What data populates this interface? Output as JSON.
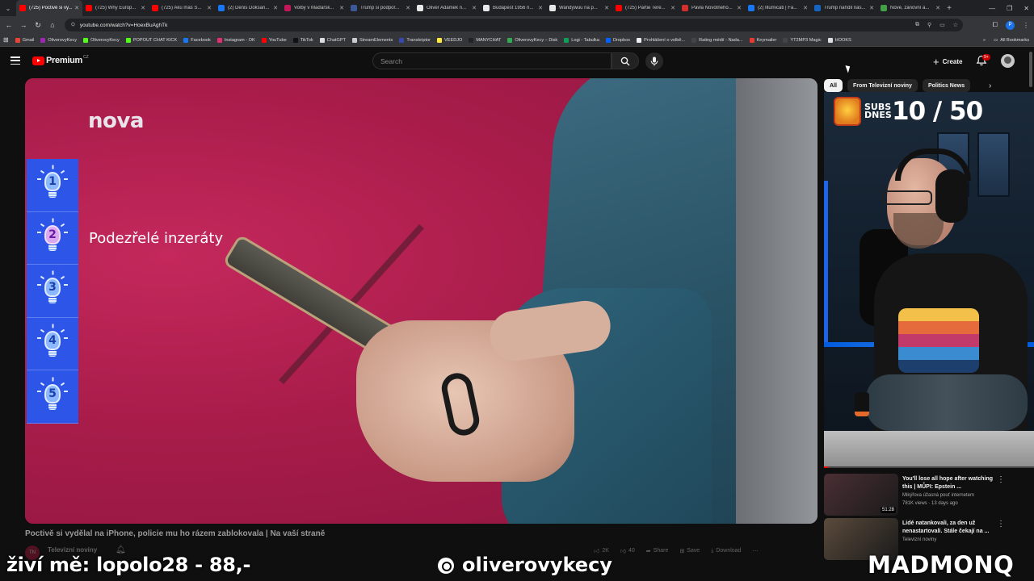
{
  "browser": {
    "tabs": [
      {
        "label": "(725) Poctivě si vy...",
        "color": "#ff0000",
        "active": true
      },
      {
        "label": "(725) Why Europ...",
        "color": "#ff0000"
      },
      {
        "label": "(725) Akú máš S...",
        "color": "#ff0000"
      },
      {
        "label": "(2) Denis Doksan...",
        "color": "#1877f2"
      },
      {
        "label": "Volby v Maďarsk...",
        "color": "#c2185b"
      },
      {
        "label": "Trump si podpor...",
        "color": "#3b5998"
      },
      {
        "label": "Oliver Adámek n...",
        "color": "#e8e8e8"
      },
      {
        "label": "Budapest 1956 n...",
        "color": "#e8e8e8"
      },
      {
        "label": "Wandywuu na p...",
        "color": "#e8e8e8"
      },
      {
        "label": "(725) Partie Tere...",
        "color": "#ff0000"
      },
      {
        "label": "Pavla Novotného...",
        "color": "#d32f2f"
      },
      {
        "label": "(2) Illumicati | Fa...",
        "color": "#1877f2"
      },
      {
        "label": "Trump nařídil nás...",
        "color": "#1565c0"
      },
      {
        "label": "Nové, zánovní a...",
        "color": "#43a047"
      }
    ],
    "url": "youtube.com/watch?v=HoexBuAghTk",
    "profile_initial": "P",
    "bookmarks": [
      {
        "label": "Gmail",
        "color": "#ea4335"
      },
      {
        "label": "OliverovyKecy",
        "color": "#9c27b0"
      },
      {
        "label": "OliverovyKecy",
        "color": "#53fc18"
      },
      {
        "label": "POPOUT CHAT KICK",
        "color": "#53fc18"
      },
      {
        "label": "Facebook",
        "color": "#1877f2"
      },
      {
        "label": "Instagram - OK",
        "color": "#e1306c"
      },
      {
        "label": "YouTube",
        "color": "#ff0000"
      },
      {
        "label": "TikTok",
        "color": "#111111"
      },
      {
        "label": "ChatGPT",
        "color": "#dddddd"
      },
      {
        "label": "StreamElements",
        "color": "#cccccc"
      },
      {
        "label": "Transkriptor",
        "color": "#3949ab"
      },
      {
        "label": "VEEDJO",
        "color": "#ffeb3b"
      },
      {
        "label": "MANYCHAT",
        "color": "#222222"
      },
      {
        "label": "OliverovyKecy – Disk",
        "color": "#34a853"
      },
      {
        "label": "Logi - Tabulka",
        "color": "#0f9d58"
      },
      {
        "label": "Dropbox",
        "color": "#0061ff"
      },
      {
        "label": "Prohlášení o volbě...",
        "color": "#eeeeee"
      },
      {
        "label": "Rating médií - Nada...",
        "color": "#444444"
      },
      {
        "label": "Keymailer",
        "color": "#e53935"
      },
      {
        "label": "YT2MP3 Magic",
        "color": "#444444"
      },
      {
        "label": "HOOKS",
        "color": "#dddddd"
      }
    ],
    "all_bookmarks": "All Bookmarks"
  },
  "youtube": {
    "logo_text": "Premium",
    "logo_region": "CZ",
    "search_placeholder": "Search",
    "create_label": "Create",
    "notif_badge": "9+"
  },
  "video": {
    "nova_logo": "nova",
    "steps": [
      "1",
      "2",
      "3",
      "4",
      "5"
    ],
    "active_step": 2,
    "step_label": "Podezřelé inzeráty",
    "title": "Poctivě si vydělal na iPhone, policie mu ho rázem zablokovala | Na vaší straně",
    "channel": "Televizní noviny",
    "channel_abbr": "TN",
    "likes": "2K",
    "dislikes_placeholder": "40",
    "share": "Share",
    "save": "Save",
    "download": "Download"
  },
  "sidebar": {
    "chips": [
      "All",
      "From Televizní noviny",
      "Politics News"
    ],
    "subs_label": "SUBS DNES",
    "subs_count": "10 / 50",
    "webcam_progress": 0.02,
    "recommendations": [
      {
        "title": "You'll lose all hope after watching this | MŮPI: Epstein ...",
        "channel": "Mikýřova úžasná pouť internetem",
        "meta": "781K views · 13 days ago",
        "duration": "51:28",
        "thumb_color": "#4a2f34"
      },
      {
        "title": "Lidé natankovali, za den už nenastartovali. Stále čekají na ...",
        "channel": "Televizní noviny",
        "meta": "",
        "duration": "",
        "thumb_color": "#5b4b3c"
      }
    ]
  },
  "overlay": {
    "left_text": "živí mě: lopolo28 - 88,-",
    "handle": "oliverovykecy",
    "right_text": "MADMONQ"
  }
}
